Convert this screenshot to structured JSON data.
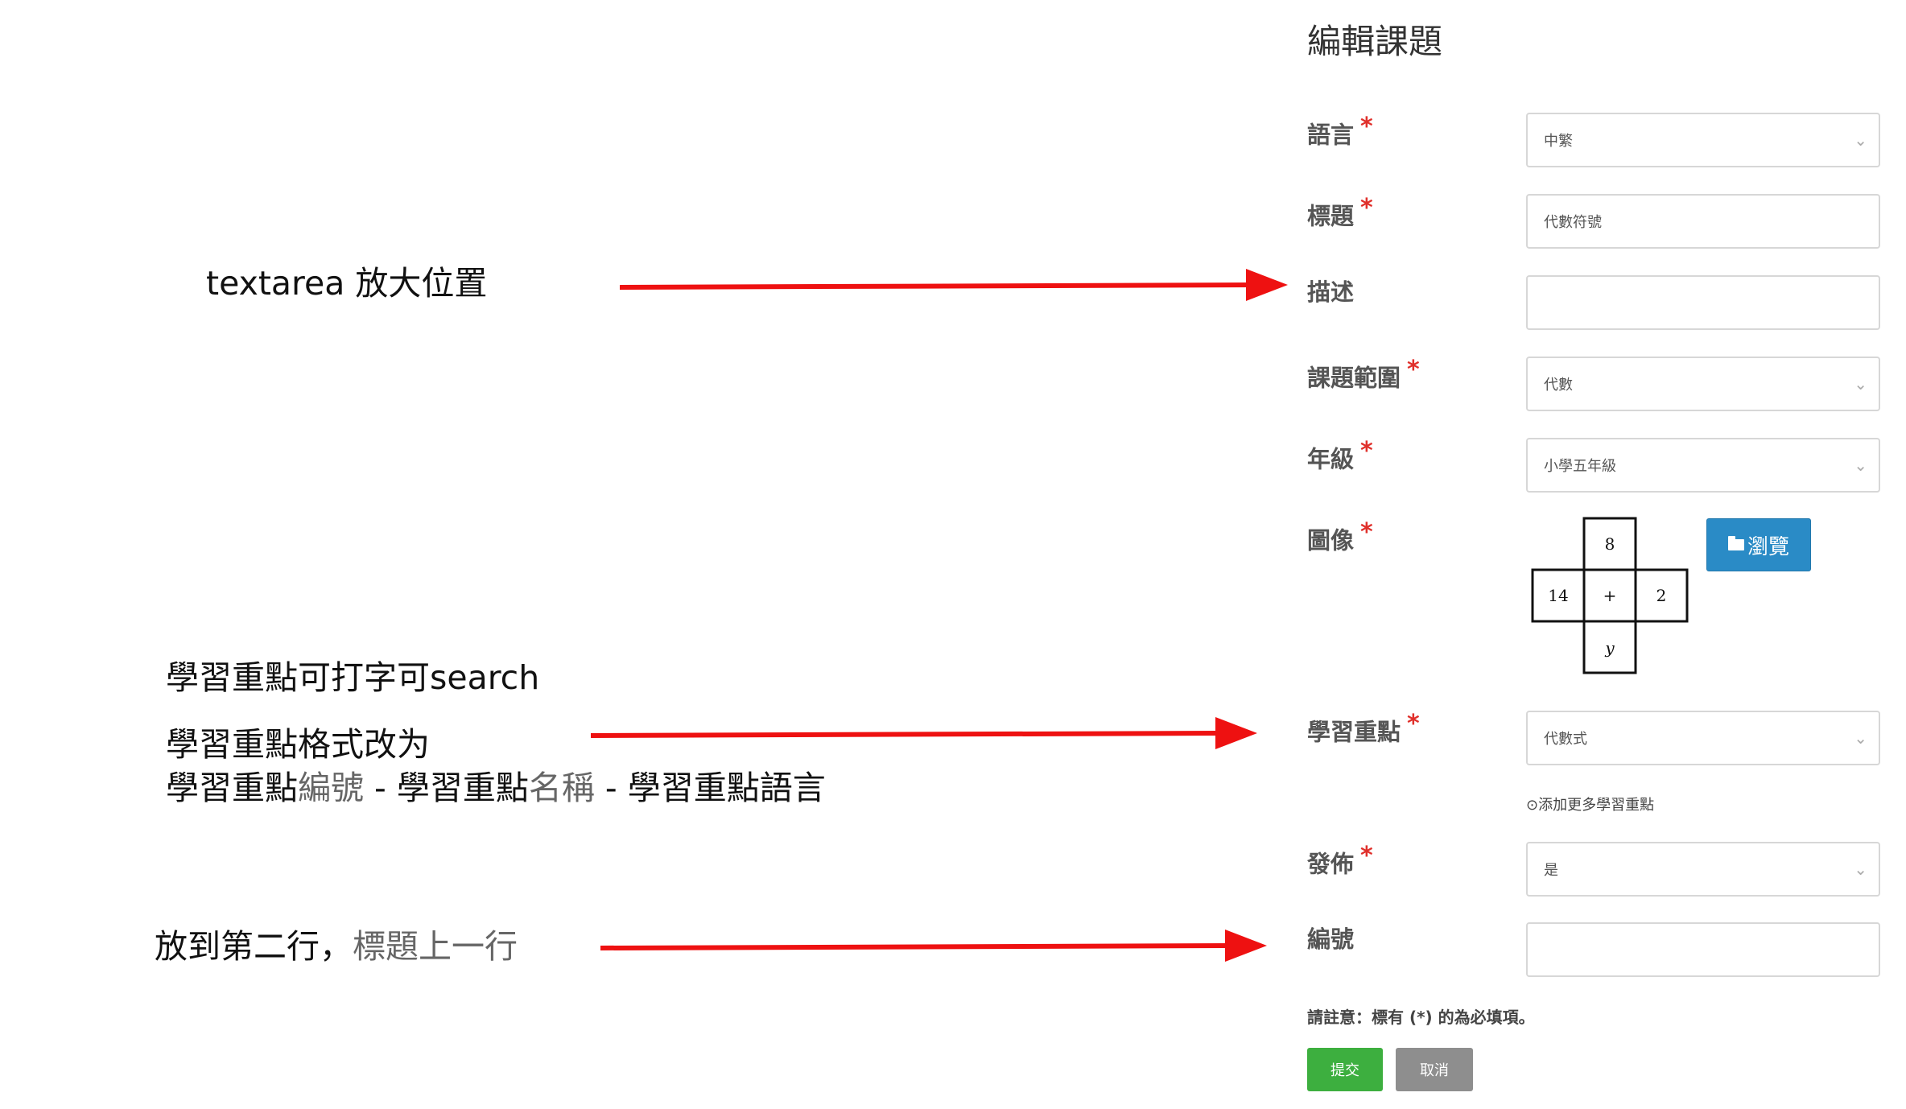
{
  "annotations": {
    "note1": "textarea 放大位置",
    "note2_line1": "學習重點可打字可search",
    "note2_line2": "學習重點格式改为",
    "note2_line3_a": "學習重點",
    "note2_line3_b": "編號",
    "note2_line3_c": " - 學習重點",
    "note2_line3_d": "名稱",
    "note2_line3_e": " - 學習重點語言",
    "note3_a": "放到第二行，",
    "note3_b": "標題上一行",
    "arrow_color": "#ee1111"
  },
  "form": {
    "title": "編輯課題",
    "required_mark": "*",
    "fields": {
      "language": {
        "label": "語言",
        "value": "中繁"
      },
      "title": {
        "label": "標題",
        "value": "代數符號"
      },
      "description": {
        "label": "描述",
        "value": ""
      },
      "topic_scope": {
        "label": "課題範圍",
        "value": "代數"
      },
      "grade": {
        "label": "年級",
        "value": "小學五年級"
      },
      "image": {
        "label": "圖像",
        "browse_label": "瀏覽"
      },
      "learning_focus": {
        "label": "學習重點",
        "value": "代數式",
        "add_more": "⊙添加更多學習重點"
      },
      "publish": {
        "label": "發佈",
        "value": "是"
      },
      "number": {
        "label": "編號",
        "value": ""
      }
    },
    "image_puzzle": {
      "top": "8",
      "left": "14",
      "center": "+",
      "right": "2",
      "bottom": "y"
    },
    "notice": "請註意：標有 (*) 的為必填項。",
    "submit_label": "提交",
    "cancel_label": "取消"
  },
  "colors": {
    "primary": "#2a8bc6",
    "success": "#3daf3f",
    "secondary": "#8e8e8e",
    "required": "#e0302b"
  }
}
